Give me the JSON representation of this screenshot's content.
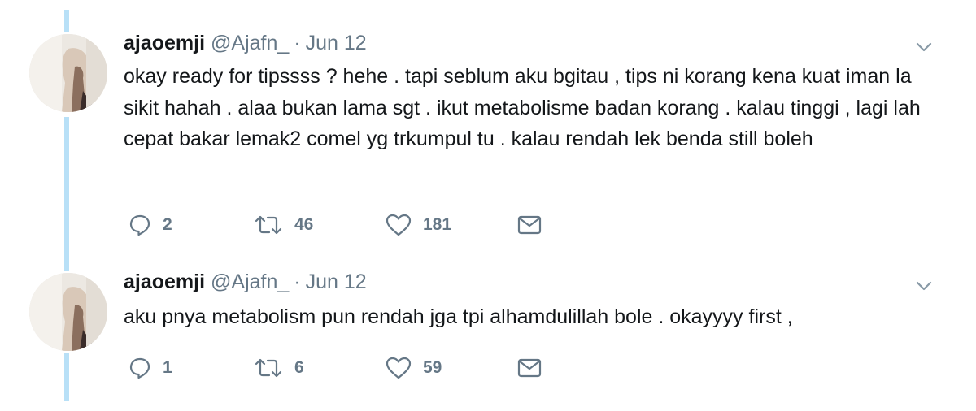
{
  "colors": {
    "thread_line": "#b8e0f7",
    "text": "#14171a",
    "secondary": "#657786"
  },
  "tweets": [
    {
      "display_name": "ajaoemji",
      "handle": "@Ajafn_",
      "separator": "·",
      "date": "Jun 12",
      "text": "okay ready for tipssss ? hehe . tapi seblum aku bgitau , tips ni korang kena kuat iman la sikit hahah . alaa bukan lama sgt . ikut metabolisme badan korang . kalau tinggi , lagi lah cepat bakar lemak2 comel yg trkumpul tu . kalau rendah lek benda still boleh",
      "replies": "2",
      "retweets": "46",
      "likes": "181",
      "icons": [
        "reply-icon",
        "retweet-icon",
        "like-icon",
        "message-icon",
        "chevron-down-icon"
      ]
    },
    {
      "display_name": "ajaoemji",
      "handle": "@Ajafn_",
      "separator": "·",
      "date": "Jun 12",
      "text": "aku pnya metabolism pun rendah jga tpi alhamdulillah bole . okayyyy first ,",
      "replies": "1",
      "retweets": "6",
      "likes": "59",
      "icons": [
        "reply-icon",
        "retweet-icon",
        "like-icon",
        "message-icon",
        "chevron-down-icon"
      ]
    }
  ]
}
